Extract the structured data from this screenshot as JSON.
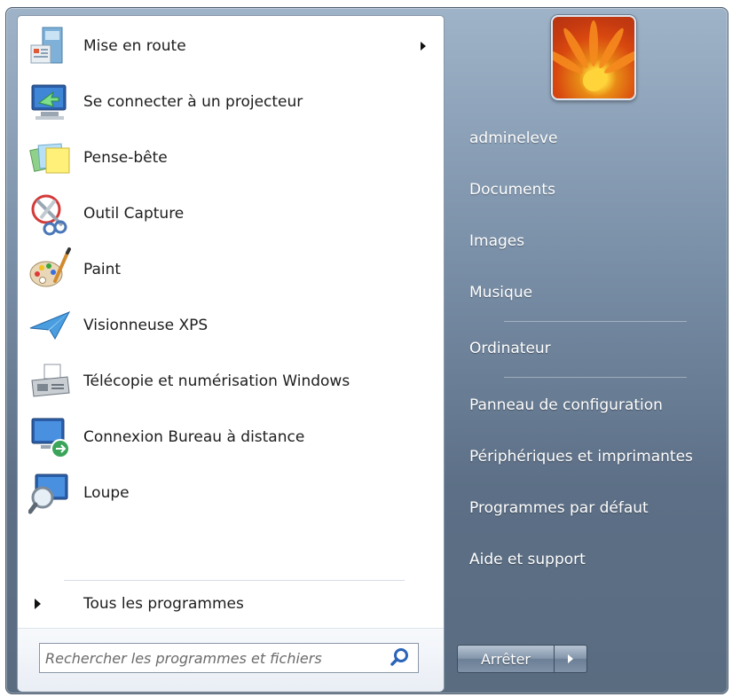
{
  "programs": [
    {
      "label": "Mise en route",
      "icon": "getting-started-icon",
      "submenu": true
    },
    {
      "label": "Se connecter à un projecteur",
      "icon": "projector-icon",
      "submenu": false
    },
    {
      "label": "Pense-bête",
      "icon": "sticky-notes-icon",
      "submenu": false
    },
    {
      "label": "Outil Capture",
      "icon": "snipping-tool-icon",
      "submenu": false
    },
    {
      "label": "Paint",
      "icon": "paint-palette-icon",
      "submenu": false
    },
    {
      "label": "Visionneuse XPS",
      "icon": "xps-viewer-icon",
      "submenu": false
    },
    {
      "label": "Télécopie et numérisation Windows",
      "icon": "fax-scan-icon",
      "submenu": false
    },
    {
      "label": "Connexion Bureau à distance",
      "icon": "remote-desktop-icon",
      "submenu": false
    },
    {
      "label": "Loupe",
      "icon": "magnifier-icon",
      "submenu": false
    }
  ],
  "all_programs_label": "Tous les programmes",
  "search": {
    "placeholder": "Rechercher les programmes et fichiers",
    "value": ""
  },
  "right_items": [
    {
      "label": "admineleve"
    },
    {
      "label": "Documents"
    },
    {
      "label": "Images"
    },
    {
      "label": "Musique"
    },
    {
      "label": "Ordinateur"
    },
    {
      "label": "Panneau de configuration"
    },
    {
      "label": "Périphériques et imprimantes"
    },
    {
      "label": "Programmes par défaut"
    },
    {
      "label": "Aide et support"
    }
  ],
  "shutdown": {
    "label": "Arrêter"
  }
}
